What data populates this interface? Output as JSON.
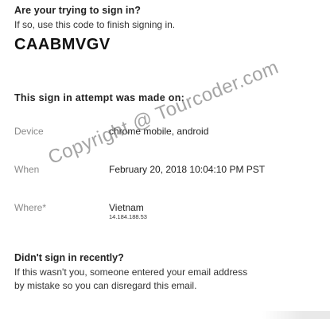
{
  "header": {
    "question": "Are your trying to sign in?",
    "instruction": "If so, use this code to finish signing in.",
    "code": "CAABMVGV"
  },
  "attempt": {
    "title": "This sign in attempt was made on:",
    "rows": [
      {
        "label": "Device",
        "value": "chrome mobile, android"
      },
      {
        "label": "When",
        "value": "February 20, 2018 10:04:10 PM PST"
      },
      {
        "label": "Where*",
        "value": "Vietnam",
        "detail": "14.184.188.53"
      }
    ]
  },
  "recent": {
    "title": "Didn't sign in recently?",
    "body": "If this wasn't you, someone entered your email address by mistake so you can disregard this email."
  },
  "watermark": {
    "text": "Copyright @ Tourcoder.com"
  }
}
